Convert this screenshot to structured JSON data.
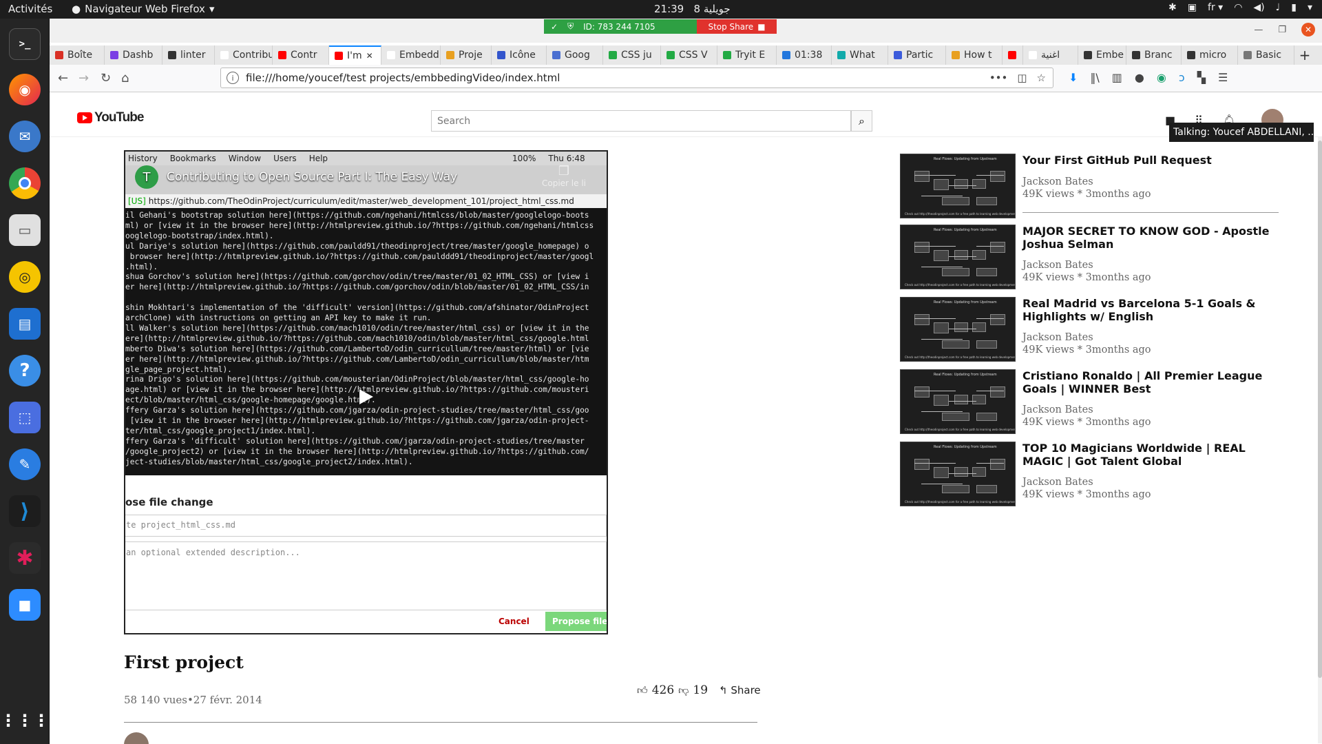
{
  "topbar": {
    "activities": "Activités",
    "app_name": "Navigateur Web Firefox",
    "clock": "21:39",
    "date": "8 جويلية",
    "lang": "fr"
  },
  "share": {
    "meeting_id": "ID: 783 244 7105",
    "stop_label": "Stop Share"
  },
  "tabs": [
    {
      "label": "Boîte",
      "color": "#d93025"
    },
    {
      "label": "Dashb",
      "color": "#7b3fe4"
    },
    {
      "label": "linter",
      "color": "#333333"
    },
    {
      "label": "Contribut",
      "color": "#ffffff"
    },
    {
      "label": "Contr",
      "color": "#ff0000"
    },
    {
      "label": "I'm",
      "color": "#ff0000",
      "active": true
    },
    {
      "label": "Embeddi",
      "color": "#ffffff"
    },
    {
      "label": "Proje",
      "color": "#e8a020"
    },
    {
      "label": "Icône",
      "color": "#3355cc"
    },
    {
      "label": "Goog",
      "color": "#4a6fd1"
    },
    {
      "label": "CSS ju",
      "color": "#22aa44"
    },
    {
      "label": "CSS V",
      "color": "#22aa44"
    },
    {
      "label": "Tryit E",
      "color": "#22aa44"
    },
    {
      "label": "01:38",
      "color": "#2277dd"
    },
    {
      "label": "What",
      "color": "#11aaaa"
    },
    {
      "label": "Partic",
      "color": "#3b5bdb"
    },
    {
      "label": "How t",
      "color": "#e8a020"
    },
    {
      "label": "",
      "color": "#ff0000"
    },
    {
      "label": "اغنية",
      "color": "#ffffff"
    },
    {
      "label": "Embe",
      "color": "#333333"
    },
    {
      "label": "Branc",
      "color": "#333333"
    },
    {
      "label": "micro",
      "color": "#333333"
    },
    {
      "label": "Basic",
      "color": "#777777"
    }
  ],
  "nav": {
    "url": "file:///home/youcef/test projects/embbedingVideo/index.html"
  },
  "youtube": {
    "logo": "YouTube",
    "search_placeholder": "Search",
    "tooltip": "Talking: Youcef ABDELLANI, ..."
  },
  "video": {
    "overlay_title": "Contributing to Open Source Part I: The Easy Way",
    "channel_initial": "T",
    "copy_label": "Copier le li",
    "os_menu": [
      "History",
      "Bookmarks",
      "Window",
      "Users",
      "Help",
      "100%",
      "Thu 6:48"
    ],
    "inner_url_tag": "[US]",
    "inner_url": "https://github.com/TheOdinProject/curriculum/edit/master/web_development_101/project_html_css.md",
    "code_lines": [
      "il Gehani's bootstrap solution here](https://github.com/ngehani/htmlcss/blob/master/googlelogo-boots",
      "ml) or [view it in the browser here](http://htmlpreview.github.io/?https://github.com/ngehani/htmlcss",
      "ooglelogo-bootstrap/index.html).",
      "ul Dariye's solution here](https://github.com/pauldd91/theodinproject/tree/master/google_homepage) o",
      " browser here](http://htmlpreview.github.io/?https://github.com/paulddd91/theodinproject/master/googl",
      ".html).",
      "shua Gorchov's solution here](https://github.com/gorchov/odin/tree/master/01_02_HTML_CSS) or [view i",
      "er here](http://htmlpreview.github.io/?https://github.com/gorchov/odin/blob/master/01_02_HTML_CSS/in",
      "",
      "shin Mokhtari's implementation of the 'difficult' version](https://github.com/afshinator/OdinProject",
      "archClone) with instructions on getting an API key to make it run.",
      "ll Walker's solution here](https://github.com/mach1010/odin/tree/master/html_css) or [view it in the",
      "ere](http://htmlpreview.github.io/?https://github.com/mach1010/odin/blob/master/html_css/google.html",
      "mberto Diwa's solution here](https://github.com/LambertoD/odin_curricullum/tree/master/html) or [vie",
      "er here](http://htmlpreview.github.io/?https://github.com/LambertoD/odin_curricullum/blob/master/htm",
      "gle_page_project.html).",
      "rina Drigo's solution here](https://github.com/mousterian/OdinProject/blob/master/html_css/google-ho",
      "age.html) or [view it in the browser here](http://htmlpreview.github.io/?https://github.com/mousteri",
      "ect/blob/master/html_css/google-homepage/google.html).",
      "ffery Garza's solution here](https://github.com/jgarza/odin-project-studies/tree/master/html_css/goo",
      " [view it in the browser here](http://htmlpreview.github.io/?https://github.com/jgarza/odin-project-",
      "ter/html_css/google_project1/index.html).",
      "ffery Garza's 'difficult' solution here](https://github.com/jgarza/odin-project-studies/tree/master",
      "/google_project2) or [view it in the browser here](http://htmlpreview.github.io/?https://github.com/",
      "ject-studies/blob/master/html_css/google_project2/index.html)."
    ],
    "form_heading": "ose file change",
    "form_input1": "te project_html_css.md",
    "form_input2": "an optional extended description...",
    "form_cancel": "Cancel",
    "form_propose": "Propose file ch"
  },
  "info": {
    "title": "First project",
    "meta": "58 140 vues•27 févr. 2014",
    "likes": "426",
    "dislikes": "19",
    "share": "Share"
  },
  "sidebar": [
    {
      "title": "Your First GitHub Pull Request",
      "channel": "Jackson Bates",
      "stats": "49K views * 3months ago"
    },
    {
      "title": "MAJOR SECRET TO KNOW GOD - Apostle Joshua Selman",
      "channel": "Jackson Bates",
      "stats": "49K views * 3months ago"
    },
    {
      "title": "Real Madrid vs Barcelona 5-1 Goals & Highlights w/ English",
      "channel": "Jackson Bates",
      "stats": "49K views * 3months ago"
    },
    {
      "title": "Cristiano Ronaldo | All Premier League Goals | WINNER Best",
      "channel": "Jackson Bates",
      "stats": "49K views * 3months ago"
    },
    {
      "title": "TOP 10 Magicians Worldwide | REAL MAGIC | Got Talent Global",
      "channel": "Jackson Bates",
      "stats": "49K views * 3months ago"
    }
  ],
  "thumb_caption": "Real Flows: Updating from Upstream",
  "thumb_footer": "Check out http://theodinproject.com for a free path to learning web development"
}
